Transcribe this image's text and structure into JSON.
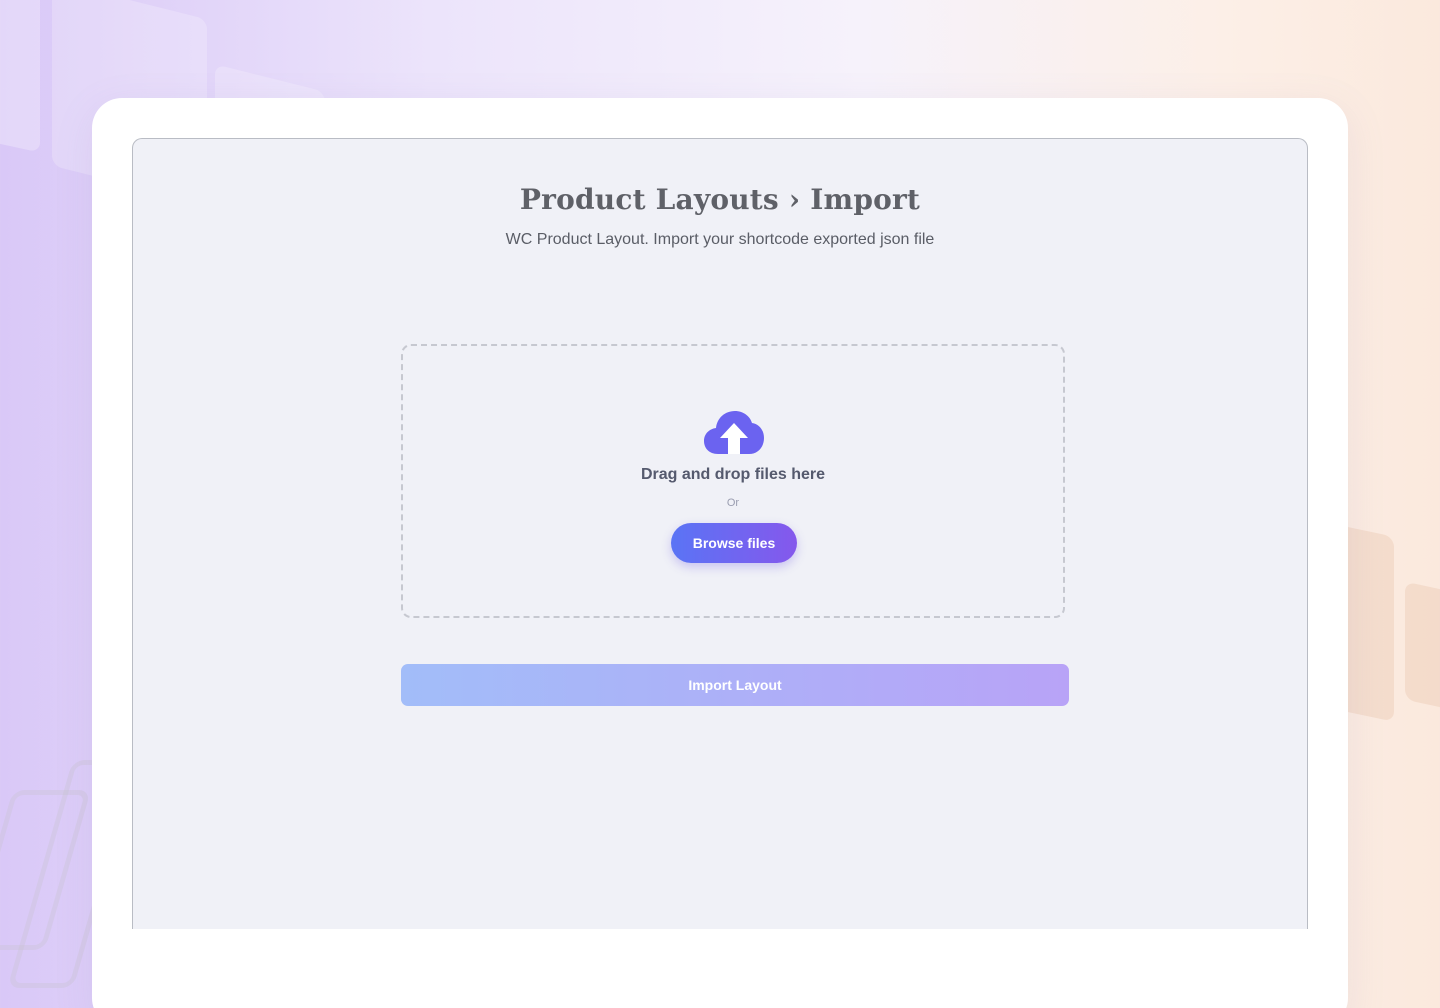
{
  "header": {
    "title": "Product Layouts › Import",
    "subtitle": "WC Product Layout. Import your shortcode exported json file"
  },
  "dropzone": {
    "icon": "cloud-upload-icon",
    "label": "Drag and drop files here",
    "or_text": "Or",
    "browse_label": "Browse files"
  },
  "actions": {
    "import_label": "Import Layout"
  },
  "colors": {
    "accent": "#6b63f0",
    "browse_gradient": [
      "#5a74f5",
      "#8558ec"
    ],
    "import_gradient": [
      "#a2bdf9",
      "#b8a3f7"
    ],
    "panel_background": "#f0f1f7"
  }
}
